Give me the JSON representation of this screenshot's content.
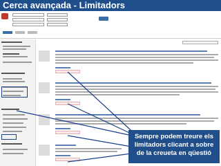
{
  "slide_title": "Cerca avançada - Limitadors",
  "callout": {
    "line1": "Sempre podem treure els",
    "line2": "limitadors clicant a sobre",
    "line3": "de la creueta en qüestió"
  }
}
